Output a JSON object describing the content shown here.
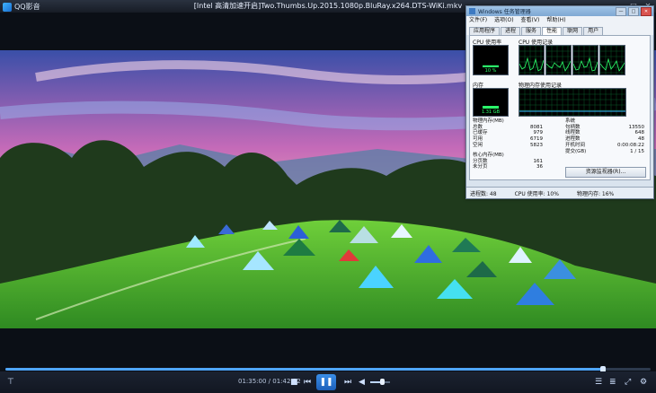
{
  "player": {
    "app_name": "QQ影音",
    "file_title": "[Intel 高清加速开启]Two.Thumbs.Up.2015.1080p.BluRay.x264.DTS-WiKi.mkv",
    "win_controls": [
      "—",
      "□",
      "✕"
    ],
    "time_display": "01:35:00 / 01:42:32",
    "progress": 0.926,
    "volume": 0.6,
    "icons": [
      "pin-icon",
      "stop-icon",
      "prev-icon",
      "play-pause-icon",
      "next-icon",
      "volume-icon",
      "equalizer-icon",
      "playlist-icon",
      "fullscreen-icon",
      "settings-icon"
    ]
  },
  "taskmgr": {
    "title": "Windows 任务管理器",
    "win_controls": [
      "—",
      "□",
      "✕"
    ],
    "menu": [
      "文件(F)",
      "选项(O)",
      "查看(V)",
      "帮助(H)"
    ],
    "tabs": [
      "应用程序",
      "进程",
      "服务",
      "性能",
      "联网",
      "用户"
    ],
    "active_tab": "性能",
    "cpu_usage_label": "CPU 使用率",
    "cpu_usage_value": "10 %",
    "cpu_history_label": "CPU 使用记录",
    "memory_label": "内存",
    "memory_value": "1.31 GB",
    "memory_history_label": "物理内存使用记录",
    "physical_memory": {
      "heading": "物理内存(MB)",
      "rows": [
        {
          "label": "总数",
          "value": "8081"
        },
        {
          "label": "已缓存",
          "value": "979"
        },
        {
          "label": "可用",
          "value": "6719"
        },
        {
          "label": "空闲",
          "value": "5823"
        }
      ]
    },
    "kernel_memory": {
      "heading": "核心内存(MB)",
      "rows": [
        {
          "label": "分页数",
          "value": "161"
        },
        {
          "label": "未分页",
          "value": "36"
        }
      ]
    },
    "system": {
      "heading": "系统",
      "rows": [
        {
          "label": "句柄数",
          "value": "13550"
        },
        {
          "label": "线程数",
          "value": "648"
        },
        {
          "label": "进程数",
          "value": "48"
        },
        {
          "label": "开机时间",
          "value": "0:00:08:22"
        },
        {
          "label": "提交(GB)",
          "value": "1 / 15"
        }
      ]
    },
    "resource_monitor_button": "资源监视器(R)...",
    "status": {
      "processes": "进程数: 48",
      "cpu": "CPU 使用率: 10%",
      "memory": "物理内存: 16%"
    },
    "cpu_usage_fraction": 0.1
  }
}
